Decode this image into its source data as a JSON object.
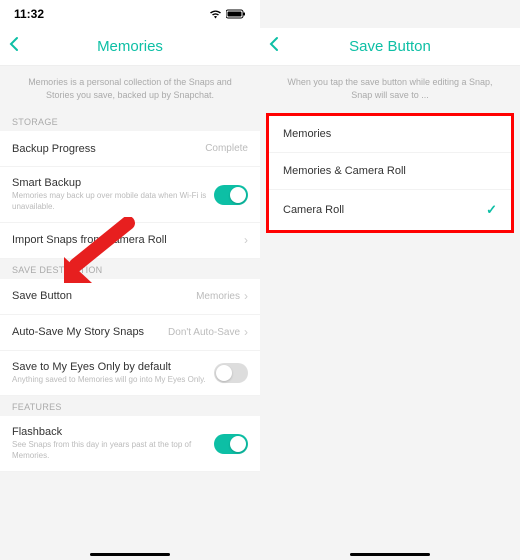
{
  "statusBar": {
    "time": "11:32"
  },
  "left": {
    "title": "Memories",
    "subtext": "Memories is a personal collection of the Snaps and Stories you save, backed up by Snapchat.",
    "sections": {
      "storage": {
        "label": "STORAGE",
        "backupProgress": {
          "title": "Backup Progress",
          "value": "Complete"
        },
        "smartBackup": {
          "title": "Smart Backup",
          "desc": "Memories may back up over mobile data when Wi-Fi is unavailable."
        },
        "importSnaps": {
          "title": "Import Snaps from Camera Roll"
        }
      },
      "saveDest": {
        "label": "SAVE DESTINATION",
        "saveButton": {
          "title": "Save Button",
          "value": "Memories"
        },
        "autoSave": {
          "title": "Auto-Save My Story Snaps",
          "value": "Don't Auto-Save"
        },
        "myEyes": {
          "title": "Save to My Eyes Only by default",
          "desc": "Anything saved to Memories will go into My Eyes Only."
        }
      },
      "features": {
        "label": "FEATURES",
        "flashback": {
          "title": "Flashback",
          "desc": "See Snaps from this day in years past at the top of Memories."
        }
      }
    }
  },
  "right": {
    "title": "Save Button",
    "subtext": "When you tap the save button while editing a Snap, Snap will save to ...",
    "options": [
      {
        "label": "Memories",
        "selected": false
      },
      {
        "label": "Memories & Camera Roll",
        "selected": false
      },
      {
        "label": "Camera Roll",
        "selected": true
      }
    ]
  }
}
